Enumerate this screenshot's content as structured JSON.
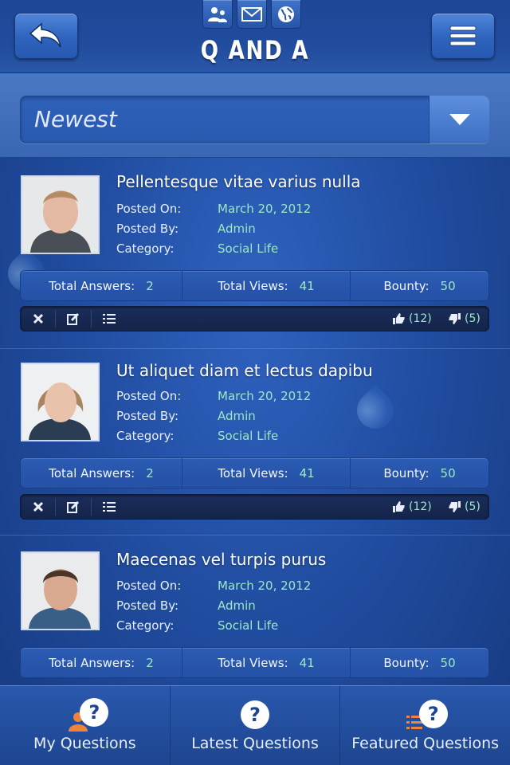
{
  "header": {
    "title": "Q AND A",
    "back_icon": "back-arrow-icon",
    "menu_icon": "hamburger-menu-icon",
    "top_icons": [
      "users-icon",
      "mail-icon",
      "globe-icon"
    ]
  },
  "filter": {
    "selected": "Newest"
  },
  "labels": {
    "posted_on": "Posted On:",
    "posted_by": "Posted By:",
    "category": "Category:",
    "total_answers": "Total Answers:",
    "total_views": "Total Views:",
    "bounty": "Bounty:"
  },
  "questions": [
    {
      "title": "Pellentesque vitae varius nulla",
      "posted_on": "March 20, 2012",
      "posted_by": "Admin",
      "category": "Social Life",
      "total_answers": "2",
      "total_views": "41",
      "bounty": "50",
      "likes": "(12)",
      "dislikes": "(5)"
    },
    {
      "title": "Ut aliquet diam et lectus dapibu",
      "posted_on": "March 20, 2012",
      "posted_by": "Admin",
      "category": "Social Life",
      "total_answers": "2",
      "total_views": "41",
      "bounty": "50",
      "likes": "(12)",
      "dislikes": "(5)"
    },
    {
      "title": "Maecenas vel turpis purus",
      "posted_on": "March 20, 2012",
      "posted_by": "Admin",
      "category": "Social Life",
      "total_answers": "2",
      "total_views": "41",
      "bounty": "50"
    }
  ],
  "tabbar": {
    "items": [
      {
        "label": "My Questions",
        "icon": "user-question-icon"
      },
      {
        "label": "Latest Questions",
        "icon": "question-icon"
      },
      {
        "label": "Featured Questions",
        "icon": "list-question-icon"
      }
    ]
  },
  "colors": {
    "accent_value": "#9be8c4",
    "background": "#1f4a9c",
    "tab_orange": "#f0823a"
  }
}
